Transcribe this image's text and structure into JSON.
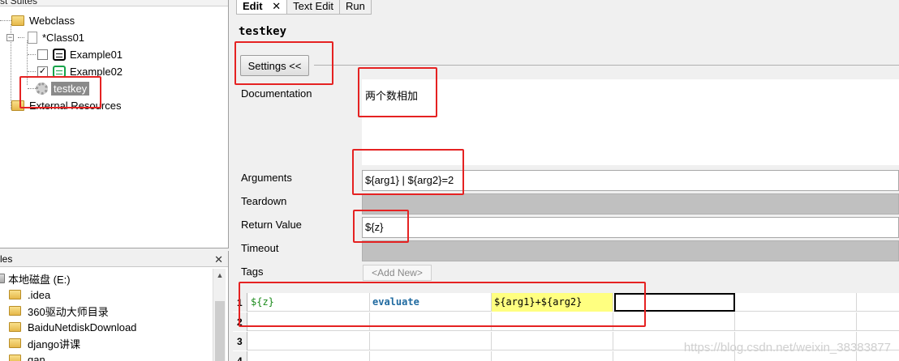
{
  "suites": {
    "title": "st Suites",
    "root": {
      "label": "Webclass",
      "expander": "−"
    },
    "class": {
      "label": "*Class01",
      "expander": "−"
    },
    "tests": [
      {
        "label": "Example01",
        "checked": false
      },
      {
        "label": "Example02",
        "checked": true
      }
    ],
    "keyword": {
      "label": "testkey"
    },
    "external": {
      "label": "External Resources"
    }
  },
  "files": {
    "title": "les",
    "close": "✕",
    "drive": "本地磁盘 (E:)",
    "items": [
      ".idea",
      "360驱动大师目录",
      "BaiduNetdiskDownload",
      "django讲课",
      "gan"
    ]
  },
  "editor": {
    "tabs": [
      {
        "label": "Edit",
        "close": "✕"
      },
      {
        "label": "Text Edit"
      },
      {
        "label": "Run"
      }
    ],
    "keyword_name": "testkey",
    "settings_button": "Settings <<",
    "fields": {
      "documentation": {
        "label": "Documentation",
        "value": "两个数相加"
      },
      "arguments": {
        "label": "Arguments",
        "value": "${arg1} | ${arg2}=2"
      },
      "teardown": {
        "label": "Teardown",
        "value": ""
      },
      "return_value": {
        "label": "Return Value",
        "value": "${z}"
      },
      "timeout": {
        "label": "Timeout",
        "value": ""
      },
      "tags": {
        "label": "Tags",
        "add_button": "<Add New>"
      }
    },
    "grid": {
      "rows": [
        {
          "num": "1",
          "cells": [
            "${z}",
            "evaluate",
            "${arg1}+${arg2}",
            "",
            ""
          ]
        },
        {
          "num": "2",
          "cells": [
            "",
            "",
            "",
            "",
            ""
          ]
        },
        {
          "num": "3",
          "cells": [
            "",
            "",
            "",
            "",
            ""
          ]
        },
        {
          "num": "4",
          "cells": [
            "",
            "",
            "",
            "",
            ""
          ]
        }
      ]
    }
  },
  "watermark": "https://blog.csdn.net/weixin_38383877",
  "colors": {
    "annotation": "#e52222",
    "variable": "#1a8a1a",
    "keyword": "#1f6aa0",
    "highlight": "#ffff80"
  }
}
